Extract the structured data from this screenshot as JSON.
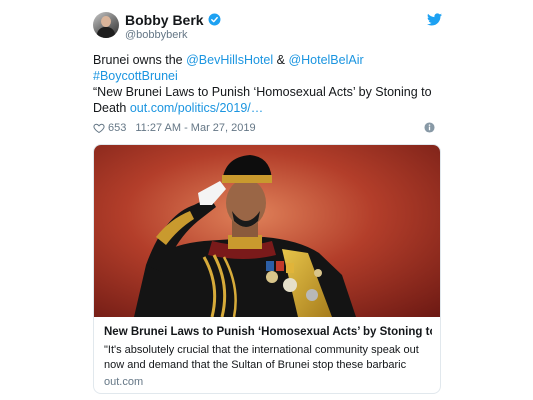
{
  "user": {
    "name": "Bobby Berk",
    "handle": "@bobbyberk"
  },
  "tweet": {
    "line1_prefix": "Brunei owns the ",
    "mention1": "@BevHillsHotel",
    "line1_mid": " & ",
    "mention2": "@HotelBelAir",
    "hashtag": "#BoycottBrunei",
    "line3": "“New Brunei Laws to Punish ‘Homosexual Acts’ by Stoning to",
    "line4_prefix": "Death ",
    "link": "out.com/politics/2019/…"
  },
  "meta": {
    "likes": "653",
    "timestamp": "11:27 AM - Mar 27, 2019"
  },
  "card": {
    "title": "New Brunei Laws to Punish ‘Homosexual Acts’ by Stoning to …",
    "desc_line1": "\"It's absolutely crucial that the international community speak out",
    "desc_line2": "now and demand that the Sultan of Brunei stop these barbaric",
    "domain": "out.com"
  },
  "colors": {
    "link": "#1b95e0",
    "verified": "#1da1f2",
    "muted": "#657786"
  },
  "icons": [
    "verified-badge-icon",
    "twitter-bird-icon",
    "heart-icon",
    "info-icon"
  ]
}
